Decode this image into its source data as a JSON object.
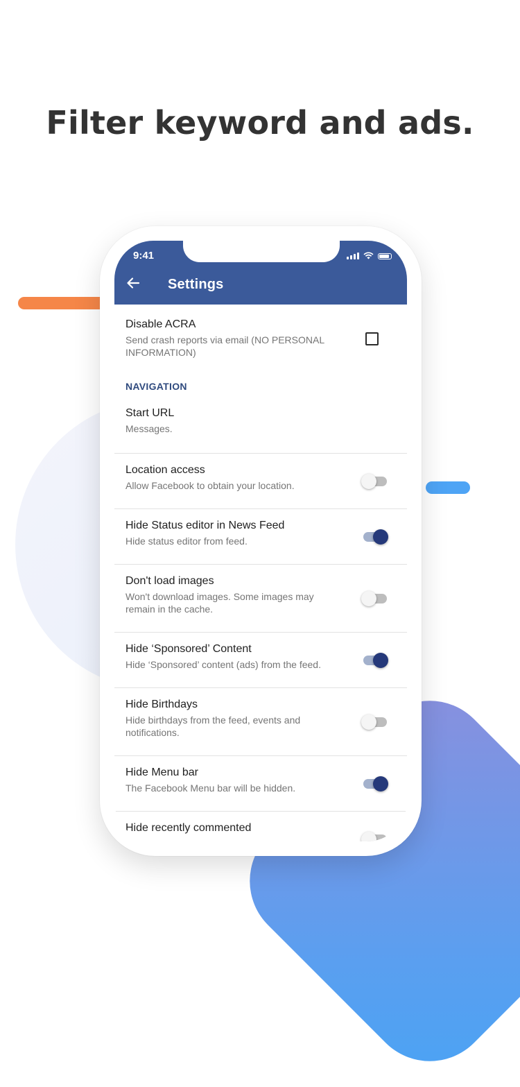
{
  "headline": "Filter keyword and ads.",
  "colors": {
    "appbar": "#3b5a9a",
    "accent": "#25397a",
    "section": "#2f4a7e",
    "orange_bar": "#f58648",
    "blue_bar": "#4ea4f5"
  },
  "status_bar": {
    "time": "9:41",
    "icons": [
      "signal-icon",
      "wifi-icon",
      "battery-icon"
    ]
  },
  "app_bar": {
    "title": "Settings",
    "back_icon": "arrow-left-icon"
  },
  "settings": {
    "acra": {
      "title": "Disable ACRA",
      "summary": "Send crash reports via email (NO PERSONAL INFORMATION)",
      "checked": false
    },
    "section_navigation": "NAVIGATION",
    "start_url": {
      "title": "Start URL",
      "summary": "Messages."
    },
    "location_access": {
      "title": "Location access",
      "summary": "Allow Facebook to obtain your location.",
      "enabled": false
    },
    "hide_status_editor": {
      "title": "Hide Status editor in News Feed",
      "summary": "Hide status editor from feed.",
      "enabled": true
    },
    "dont_load_images": {
      "title": "Don't load images",
      "summary": "Won't download images. Some images may remain in the cache.",
      "enabled": false
    },
    "hide_sponsored": {
      "title": "Hide ‘Sponsored’ Content",
      "summary": "Hide ‘Sponsored’ content (ads) from the feed.",
      "enabled": true
    },
    "hide_birthdays": {
      "title": "Hide Birthdays",
      "summary": "Hide birthdays from the feed, events and notifications.",
      "enabled": false
    },
    "hide_menu_bar": {
      "title": "Hide Menu bar",
      "summary": "The Facebook Menu bar will be hidden.",
      "enabled": true
    },
    "hide_recently_commented": {
      "title": "Hide recently commented",
      "enabled": false
    }
  }
}
